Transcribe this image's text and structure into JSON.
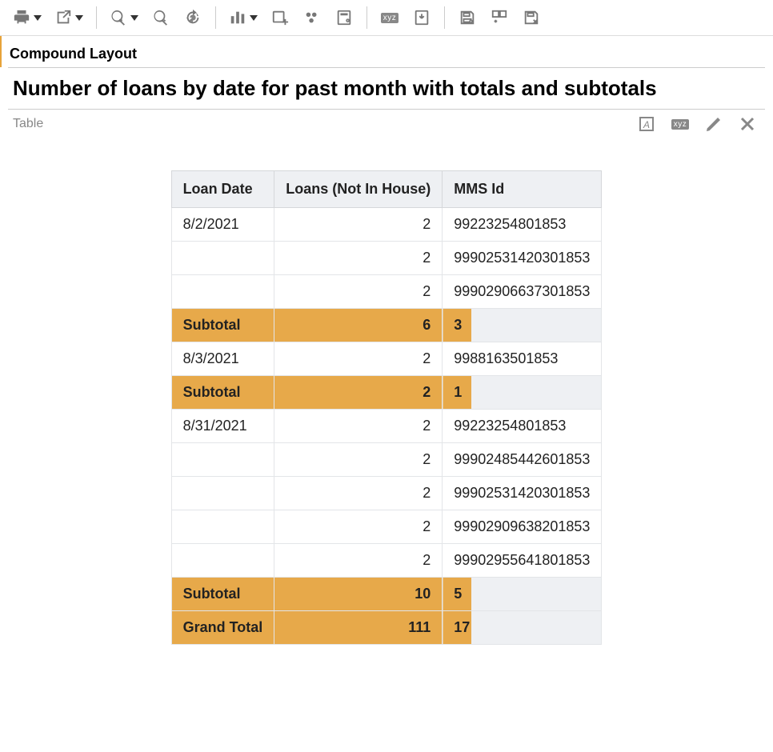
{
  "toolbar": {
    "buttons": [
      {
        "name": "print-button",
        "icon": "print",
        "caret": true
      },
      {
        "name": "export-button",
        "icon": "export",
        "caret": true
      },
      {
        "name": "sep"
      },
      {
        "name": "find-button",
        "icon": "find",
        "caret": true
      },
      {
        "name": "find-gear-button",
        "icon": "findgear",
        "caret": false
      },
      {
        "name": "refresh-button",
        "icon": "refresh",
        "caret": false
      },
      {
        "name": "sep"
      },
      {
        "name": "chart-button",
        "icon": "bars",
        "caret": true
      },
      {
        "name": "add-view-button",
        "icon": "addview",
        "caret": false
      },
      {
        "name": "related-button",
        "icon": "dots",
        "caret": false
      },
      {
        "name": "calc-button",
        "icon": "calc",
        "caret": false
      },
      {
        "name": "sep"
      },
      {
        "name": "xyz-button",
        "icon": "xyz",
        "caret": false
      },
      {
        "name": "import-button",
        "icon": "import",
        "caret": false
      },
      {
        "name": "sep"
      },
      {
        "name": "save-button",
        "icon": "save",
        "caret": false
      },
      {
        "name": "saveas-button",
        "icon": "saveas",
        "caret": false
      },
      {
        "name": "delete-button",
        "icon": "delete",
        "caret": false
      }
    ]
  },
  "section": {
    "label": "Compound Layout"
  },
  "title": {
    "text": "Number of loans by date for past month with totals and subtotals"
  },
  "view": {
    "name": "Table",
    "icons": [
      {
        "name": "format-icon",
        "icon": "format"
      },
      {
        "name": "xyz-icon",
        "icon": "xyz"
      },
      {
        "name": "edit-icon",
        "icon": "pencil"
      },
      {
        "name": "close-icon",
        "icon": "close"
      }
    ]
  },
  "table": {
    "headers": [
      "Loan Date",
      "Loans (Not In House)",
      "MMS Id"
    ],
    "rows": [
      {
        "type": "data",
        "date": "8/2/2021",
        "loans": "2",
        "mms": "99223254801853"
      },
      {
        "type": "data",
        "date": "",
        "loans": "2",
        "mms": "99902531420301853"
      },
      {
        "type": "data",
        "date": "",
        "loans": "2",
        "mms": "99902906637301853"
      },
      {
        "type": "subtotal",
        "date": "Subtotal",
        "loans": "6",
        "mms": "3"
      },
      {
        "type": "data",
        "date": "8/3/2021",
        "loans": "2",
        "mms": "9988163501853"
      },
      {
        "type": "subtotal",
        "date": "Subtotal",
        "loans": "2",
        "mms": "1"
      },
      {
        "type": "data",
        "date": "8/31/2021",
        "loans": "2",
        "mms": "99223254801853"
      },
      {
        "type": "data",
        "date": "",
        "loans": "2",
        "mms": "99902485442601853"
      },
      {
        "type": "data",
        "date": "",
        "loans": "2",
        "mms": "99902531420301853"
      },
      {
        "type": "data",
        "date": "",
        "loans": "2",
        "mms": "99902909638201853"
      },
      {
        "type": "data",
        "date": "",
        "loans": "2",
        "mms": "99902955641801853"
      },
      {
        "type": "subtotal",
        "date": "Subtotal",
        "loans": "10",
        "mms": "5"
      },
      {
        "type": "subtotal",
        "date": "Grand Total",
        "loans": "111",
        "mms": "17"
      }
    ]
  }
}
